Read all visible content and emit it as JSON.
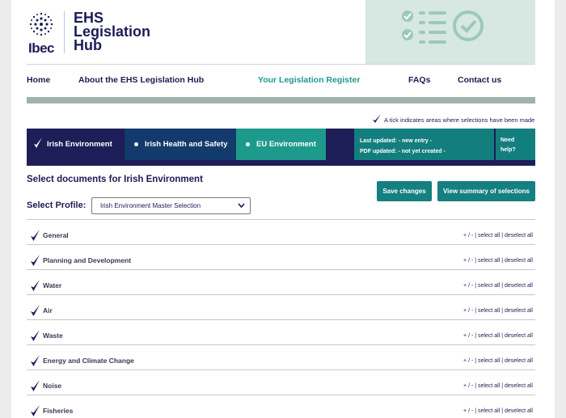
{
  "brand": {
    "logo_text": "Ibec",
    "hub_title_line1": "EHS",
    "hub_title_line2": "Legislation",
    "hub_title_line3": "Hub"
  },
  "nav": {
    "home": "Home",
    "about": "About the EHS Legislation Hub",
    "register": "Your Legislation Register",
    "faqs": "FAQs",
    "contact": "Contact us"
  },
  "legend": {
    "tick_note": "A tick indicates areas where selections have been made"
  },
  "tabs": {
    "irish_env": "Irish Environment",
    "irish_hs": "Irish Health and Safety",
    "eu_env": "EU Environment"
  },
  "updated": {
    "last": "Last updated: - new entry -",
    "pdf": "PDF updated: - not yet created -"
  },
  "help": {
    "line1": "Need",
    "line2": "help?"
  },
  "select": {
    "title": "Select documents for Irish Environment",
    "profile_label": "Select Profile:",
    "profile_value": "Irish Environment Master Selection"
  },
  "buttons": {
    "save": "Save changes",
    "summary": "View summary of selections"
  },
  "row_actions": {
    "toggle": "+ / -",
    "sep": "|",
    "select_all": "select all",
    "deselect_all": "deselect all"
  },
  "categories": [
    "General",
    "Planning and Development",
    "Water",
    "Air",
    "Waste",
    "Energy and Climate Change",
    "Noise",
    "Fisheries"
  ],
  "colors": {
    "navy": "#1d1d57",
    "teal": "#1d9a8b",
    "dark_teal": "#137e7e",
    "blue": "#133a6c"
  }
}
